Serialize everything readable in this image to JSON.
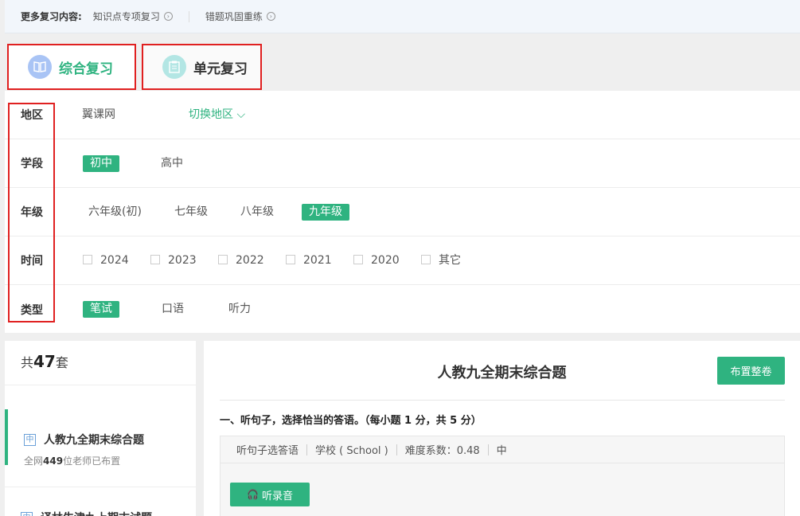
{
  "topbar": {
    "more_label": "更多复习内容:",
    "link1": "知识点专项复习",
    "link2": "错题巩固重练"
  },
  "tabs": [
    {
      "label": "综合复习",
      "icon": "book-icon"
    },
    {
      "label": "单元复习",
      "icon": "clipboard-icon"
    }
  ],
  "filters": {
    "region": {
      "label": "地区",
      "value": "翼课网",
      "switch": "切换地区"
    },
    "stage": {
      "label": "学段",
      "options": [
        "初中",
        "高中"
      ],
      "selected": "初中"
    },
    "grade": {
      "label": "年级",
      "options": [
        "六年级(初)",
        "七年级",
        "八年级",
        "九年级"
      ],
      "selected": "九年级"
    },
    "time": {
      "label": "时间",
      "options": [
        "2024",
        "2023",
        "2022",
        "2021",
        "2020",
        "其它"
      ]
    },
    "type": {
      "label": "类型",
      "options": [
        "笔试",
        "口语",
        "听力"
      ],
      "selected": "笔试"
    }
  },
  "left": {
    "count_prefix": "共",
    "count": "47",
    "count_suffix": "套",
    "items": [
      {
        "title": "人教九全期末综合题",
        "sub_prefix": "全网",
        "sub_count": "449",
        "sub_suffix": "位老师已布置"
      },
      {
        "title": "译林牛津九上期末试题"
      }
    ]
  },
  "right": {
    "title": "人教九全期末综合题",
    "assign_button": "布置整卷",
    "section": "一、听句子，选择恰当的答语。（每小题 1 分，共 5 分）",
    "meta": [
      "听句子选答语",
      "学校 ( School )",
      "难度系数：0.48",
      "中"
    ],
    "listen_button": "听录音"
  },
  "colors": {
    "accent": "#2fb380",
    "highlight_box": "#e02020"
  }
}
